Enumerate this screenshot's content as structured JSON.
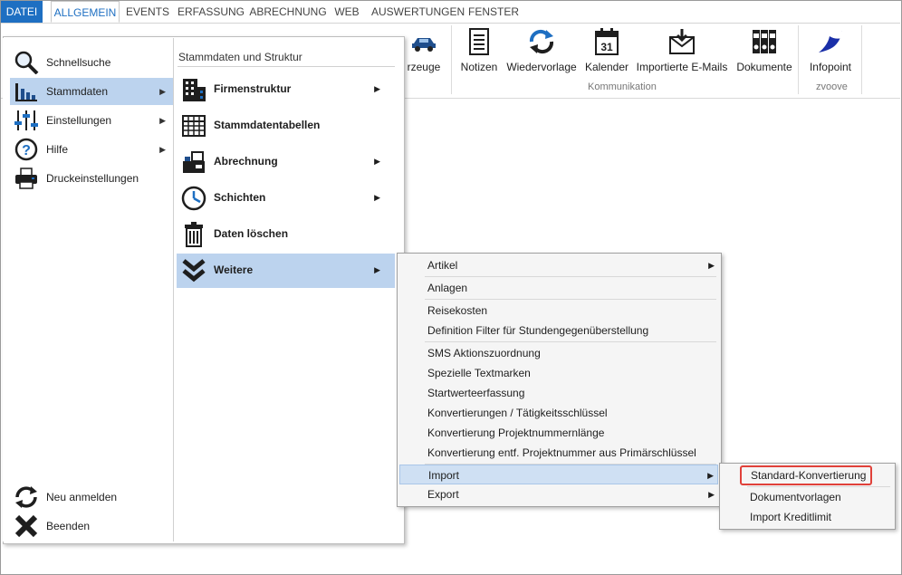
{
  "tabs": [
    "DATEI",
    "ALLGEMEIN",
    "EVENTS",
    "ERFASSUNG",
    "ABRECHNUNG",
    "WEB",
    "AUSWERTUNGEN",
    "FENSTER"
  ],
  "ribbon": {
    "partial_label": "rzeuge",
    "buttons": [
      "Notizen",
      "Wiedervorlage",
      "Kalender",
      "Importierte E-Mails",
      "Dokumente",
      "Infopoint"
    ],
    "calendar_day": "31",
    "groups": [
      "Kommunikation",
      "zvoove"
    ]
  },
  "left_menu": {
    "items": [
      "Schnellsuche",
      "Stammdaten",
      "Einstellungen",
      "Hilfe",
      "Druckeinstellungen"
    ],
    "bottom_items": [
      "Neu anmelden",
      "Beenden"
    ]
  },
  "middle_menu": {
    "header": "Stammdaten und Struktur",
    "items": [
      "Firmenstruktur",
      "Stammdatentabellen",
      "Abrechnung",
      "Schichten",
      "Daten löschen",
      "Weitere"
    ]
  },
  "weitere_submenu": {
    "items": [
      "Artikel",
      "Anlagen",
      "Reisekosten",
      "Definition Filter für Stundengegenüberstellung",
      "SMS Aktionszuordnung",
      "Spezielle Textmarken",
      "Startwerteerfassung",
      "Konvertierungen / Tätigkeitsschlüssel",
      "Konvertierung Projektnummernlänge",
      "Konvertierung entf. Projektnummer aus Primärschlüssel",
      "Import",
      "Export"
    ]
  },
  "import_submenu": {
    "items": [
      "Standard-Konvertierung",
      "Dokumentvorlagen",
      "Import Kreditlimit"
    ]
  },
  "colors": {
    "accent": "#1e6fc2",
    "selection": "#bcd3ee",
    "highlight": "#e0413a"
  }
}
